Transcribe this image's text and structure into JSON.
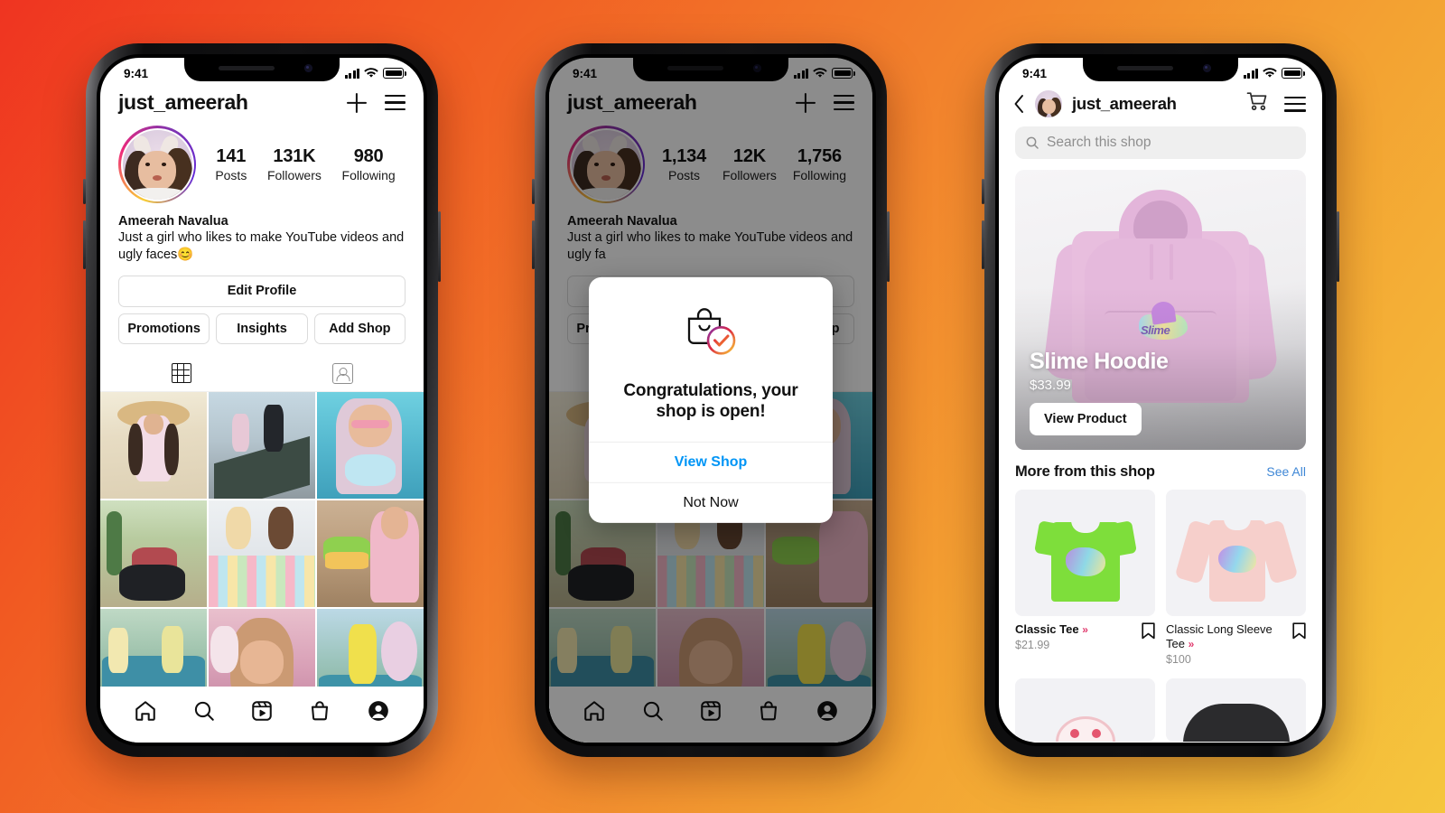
{
  "background": {
    "from": "#ef3421",
    "via": "#f2802c",
    "to": "#f5c63d"
  },
  "phones": [
    {
      "id": "profile-before",
      "status_bar": {
        "time": "9:41",
        "signal": "signal-bars-icon",
        "wifi": "wifi-icon",
        "battery": "battery-full-icon"
      },
      "header": {
        "username": "just_ameerah",
        "add_icon": "plus-icon",
        "menu_icon": "hamburger-menu-icon"
      },
      "stats": [
        {
          "num": "141",
          "label": "Posts"
        },
        {
          "num": "131K",
          "label": "Followers"
        },
        {
          "num": "980",
          "label": "Following"
        }
      ],
      "bio": {
        "name": "Ameerah Navalua",
        "text": "Just a girl who likes to make YouTube videos and ugly faces😊"
      },
      "buttons": {
        "edit_profile": "Edit Profile",
        "promotions": "Promotions",
        "insights": "Insights",
        "add_shop": "Add Shop"
      },
      "tabs": [
        {
          "icon": "grid-icon",
          "active": true
        },
        {
          "icon": "tagged-photos-icon",
          "active": false
        }
      ],
      "bottom_nav": [
        "home-icon",
        "search-icon",
        "reels-icon",
        "shop-bag-icon",
        "profile-avatar-icon"
      ]
    },
    {
      "id": "shop-open-confirmation",
      "status_bar": {
        "time": "9:41"
      },
      "header": {
        "username": "just_ameerah",
        "add_icon": "plus-icon",
        "menu_icon": "hamburger-menu-icon"
      },
      "stats": [
        {
          "num": "1,134",
          "label": "Posts"
        },
        {
          "num": "12K",
          "label": "Followers"
        },
        {
          "num": "1,756",
          "label": "Following"
        }
      ],
      "bio": {
        "name": "Ameerah Navalua",
        "text": "Just a girl who likes to make YouTube videos and ugly fa"
      },
      "modal": {
        "icon": "shopping-bag-check-icon",
        "title": "Congratulations, your shop is open!",
        "primary_action": "View Shop",
        "secondary_action": "Not Now"
      },
      "bottom_nav": [
        "home-icon",
        "search-icon",
        "reels-icon",
        "shop-bag-icon",
        "profile-avatar-icon"
      ]
    },
    {
      "id": "shop-storefront",
      "status_bar": {
        "time": "9:41"
      },
      "header": {
        "back_icon": "chevron-left-icon",
        "avatar": "profile-avatar-icon",
        "username": "just_ameerah",
        "cart_icon": "shopping-cart-icon",
        "menu_icon": "hamburger-menu-icon"
      },
      "search": {
        "icon": "search-icon",
        "placeholder": "Search this shop"
      },
      "hero": {
        "title": "Slime Hoodie",
        "price": "$33.99",
        "cta": "View Product"
      },
      "section": {
        "title": "More from this shop",
        "link": "See All"
      },
      "products": [
        {
          "name": "Classic Tee",
          "price": "$21.99",
          "badge": "chevrons-right-icon",
          "save_icon": "bookmark-icon",
          "bold": true
        },
        {
          "name": "Classic Long Sleeve Tee",
          "price": "$100",
          "badge": "chevrons-right-icon",
          "save_icon": "bookmark-icon",
          "bold": false
        }
      ]
    }
  ]
}
